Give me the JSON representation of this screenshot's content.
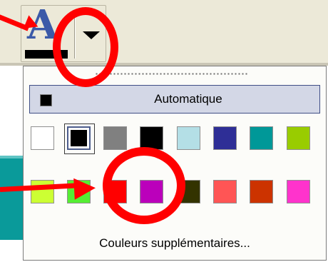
{
  "toolbar": {
    "font_color_glyph": "A",
    "font_color_button_icon": "font-color-icon",
    "dropdown_icon": "chevron-down-icon",
    "current_color": "#000000"
  },
  "palette": {
    "automatic_label": "Automatique",
    "automatic_color": "#000000",
    "rows": [
      [
        {
          "color": "#ffffff",
          "selected": false
        },
        {
          "color": "#000000",
          "selected": true
        },
        {
          "color": "#808080",
          "selected": false
        },
        {
          "color": "#000000",
          "selected": false
        },
        {
          "color": "#b4dfe6",
          "selected": false
        },
        {
          "color": "#2e2e96",
          "selected": false
        },
        {
          "color": "#009898",
          "selected": false
        },
        {
          "color": "#99cc00",
          "selected": false
        }
      ],
      [
        {
          "color": "#ccff33",
          "selected": false
        },
        {
          "color": "#55ee33",
          "selected": false
        },
        {
          "color": "#ff0000",
          "selected": false
        },
        {
          "color": "#bb00bb",
          "selected": false
        },
        {
          "color": "#333300",
          "selected": false
        },
        {
          "color": "#ff5555",
          "selected": false
        },
        {
          "color": "#cc3300",
          "selected": false
        },
        {
          "color": "#ff33cc",
          "selected": false
        }
      ]
    ],
    "more_colors_label": "Couleurs supplémentaires..."
  },
  "annotations": {
    "color": "#ff0000",
    "marks": [
      "red-circle",
      "red-circle",
      "red-arrow",
      "red-arrow"
    ]
  }
}
